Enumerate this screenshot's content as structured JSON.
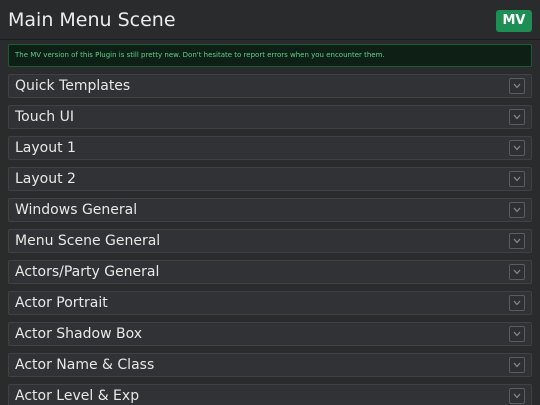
{
  "header": {
    "title": "Main Menu Scene",
    "badge": "MV"
  },
  "notice": {
    "text": "The MV version of this Plugin is still pretty new. Don't hesitate to report errors when you encounter them."
  },
  "sections": [
    {
      "label": "Quick Templates"
    },
    {
      "label": "Touch UI"
    },
    {
      "label": "Layout 1"
    },
    {
      "label": "Layout 2"
    },
    {
      "label": "Windows General"
    },
    {
      "label": "Menu Scene General"
    },
    {
      "label": "Actors/Party General"
    },
    {
      "label": "Actor Portrait"
    },
    {
      "label": "Actor Shadow Box"
    },
    {
      "label": "Actor Name & Class"
    },
    {
      "label": "Actor Level & Exp"
    }
  ],
  "colors": {
    "background": "#2a2b2d",
    "badge": "#1e8f54",
    "notice_text": "#5fcf8a",
    "notice_bg": "#0e2016"
  },
  "icons": {
    "section_toggle": "chevron-down-icon"
  }
}
